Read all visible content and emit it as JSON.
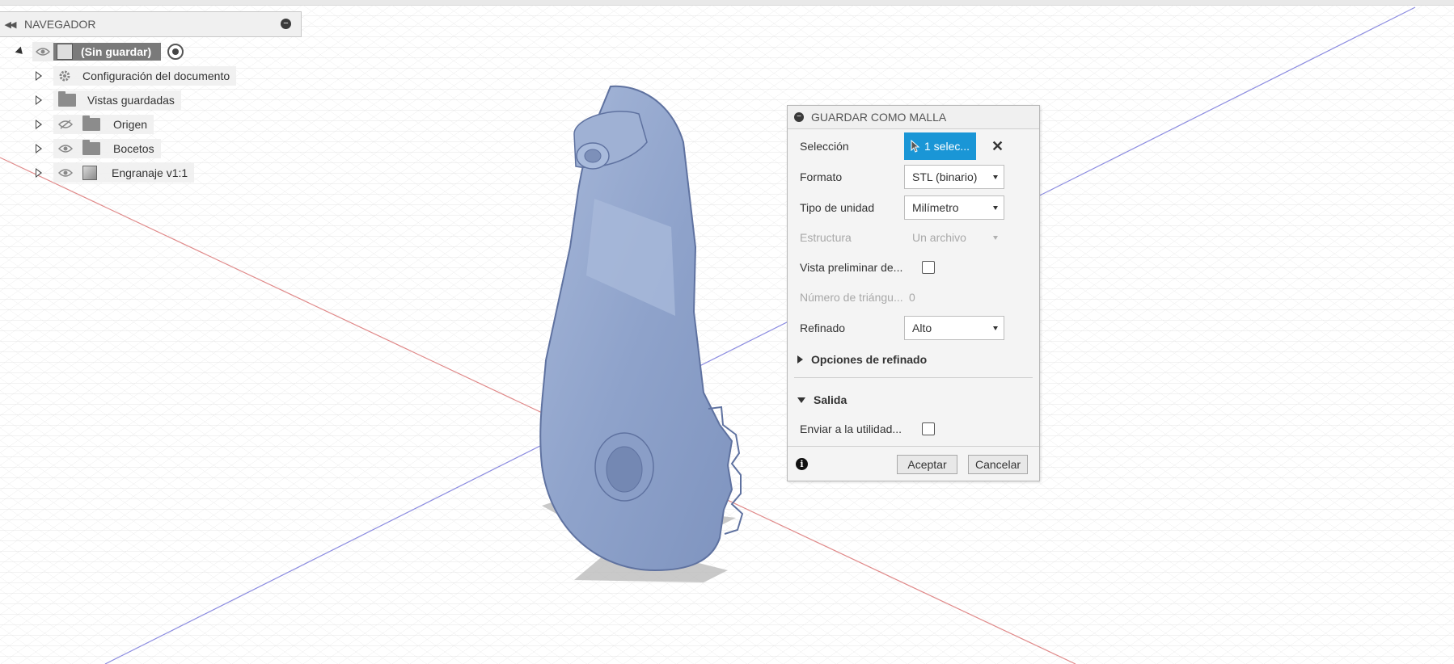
{
  "navigator": {
    "title": "NAVEGADOR",
    "root_label": "(Sin guardar)",
    "items": [
      {
        "label": "Configuración del documento",
        "icon": "gear-icon"
      },
      {
        "label": "Vistas guardadas",
        "icon": "folder-icon"
      },
      {
        "label": "Origen",
        "icon": "folder-icon",
        "visibility": "hidden-eye-icon"
      },
      {
        "label": "Bocetos",
        "icon": "folder-icon",
        "visibility": "eye-icon"
      },
      {
        "label": "Engranaje v1:1",
        "icon": "body-icon",
        "visibility": "eye-icon"
      }
    ]
  },
  "dialog": {
    "title": "GUARDAR COMO MALLA",
    "seleccion": {
      "label": "Selección",
      "value": "1 selec..."
    },
    "formato": {
      "label": "Formato",
      "value": "STL (binario)"
    },
    "tipo_unidad": {
      "label": "Tipo de unidad",
      "value": "Milímetro"
    },
    "estructura": {
      "label": "Estructura",
      "value": "Un archivo",
      "disabled": true
    },
    "vista_preliminar": {
      "label": "Vista preliminar de...",
      "checked": false
    },
    "num_triangulos": {
      "label": "Número de triángu...",
      "value": "0"
    },
    "refinado": {
      "label": "Refinado",
      "value": "Alto"
    },
    "opciones_refinado": "Opciones de refinado",
    "salida": "Salida",
    "enviar": {
      "label": "Enviar a la utilidad...",
      "checked": false
    },
    "ok_label": "Aceptar",
    "cancel_label": "Cancelar"
  },
  "colors": {
    "accent": "#1a96d6",
    "model": "#8fa4cc",
    "grid": "#d4d4d4"
  }
}
